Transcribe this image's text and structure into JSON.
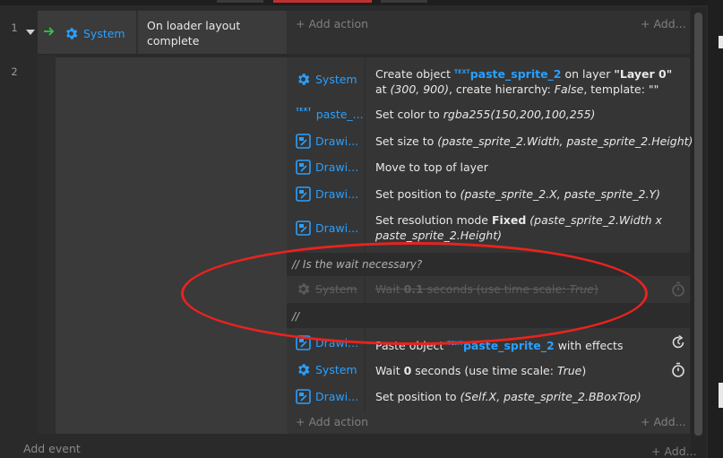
{
  "colors": {
    "accent": "#2aa0ff",
    "highlight_ellipse": "#e8231e",
    "trigger_arrow": "#3ec04b"
  },
  "rows": {
    "row1_number": "1",
    "row2_number": "2"
  },
  "event1": {
    "condition_object": "System",
    "condition_text": "On loader layout complete",
    "add_action": "+ Add action",
    "add_right": "+ Add..."
  },
  "actions": [
    {
      "object": "System",
      "icon": "gear-icon",
      "text": "Create object",
      "badge": "TEXT",
      "obj": "paste_sprite_2",
      "mid": "on layer",
      "layer": "\"Layer 0\"",
      "mid2": "at",
      "coords": "(300, 900)",
      "mid3": ", create hierarchy:",
      "hier": "False",
      "mid4": ", template: \"\""
    },
    {
      "object": "paste_...",
      "icon": "text-badge-icon",
      "text": "Set color to",
      "arg": "rgba255(150,200,100,255)"
    },
    {
      "object": "Drawi...",
      "icon": "drawing-canvas-icon",
      "text": "Set size to",
      "arg": "(paste_sprite_2.Width, paste_sprite_2.Height)"
    },
    {
      "object": "Drawi...",
      "icon": "drawing-canvas-icon",
      "text": "Move to top of layer"
    },
    {
      "object": "Drawi...",
      "icon": "drawing-canvas-icon",
      "text": "Set position to",
      "arg": "(paste_sprite_2.X, paste_sprite_2.Y)"
    },
    {
      "object": "Drawi...",
      "icon": "drawing-canvas-icon",
      "text": "Set resolution mode",
      "bold": "Fixed",
      "arg": "(paste_sprite_2.Width x paste_sprite_2.Height)"
    }
  ],
  "comment1": "//  Is the wait necessary?",
  "disabled_action": {
    "object": "System",
    "pre": "Wait",
    "value": "0.1",
    "post": "seconds (use time scale:",
    "scale": "True",
    "close": ")"
  },
  "comment2": "//",
  "actions2": [
    {
      "object": "Drawi...",
      "icon": "drawing-canvas-icon",
      "pre": "Paste object",
      "badge": "TEXT",
      "obj": "paste_sprite_2",
      "post": "with effects"
    },
    {
      "object": "System",
      "icon": "gear-icon",
      "pre": "Wait",
      "value": "0",
      "post": "seconds (use time scale:",
      "scale": "True",
      "close": ")"
    },
    {
      "object": "Drawi...",
      "icon": "drawing-canvas-icon",
      "pre": "Set position to",
      "arg": "(Self.X, paste_sprite_2.BBoxTop)"
    }
  ],
  "event2": {
    "add_action": "+ Add action",
    "add_right": "+ Add..."
  },
  "footer": {
    "add_event": "Add event",
    "add_right": "+ Add..."
  }
}
